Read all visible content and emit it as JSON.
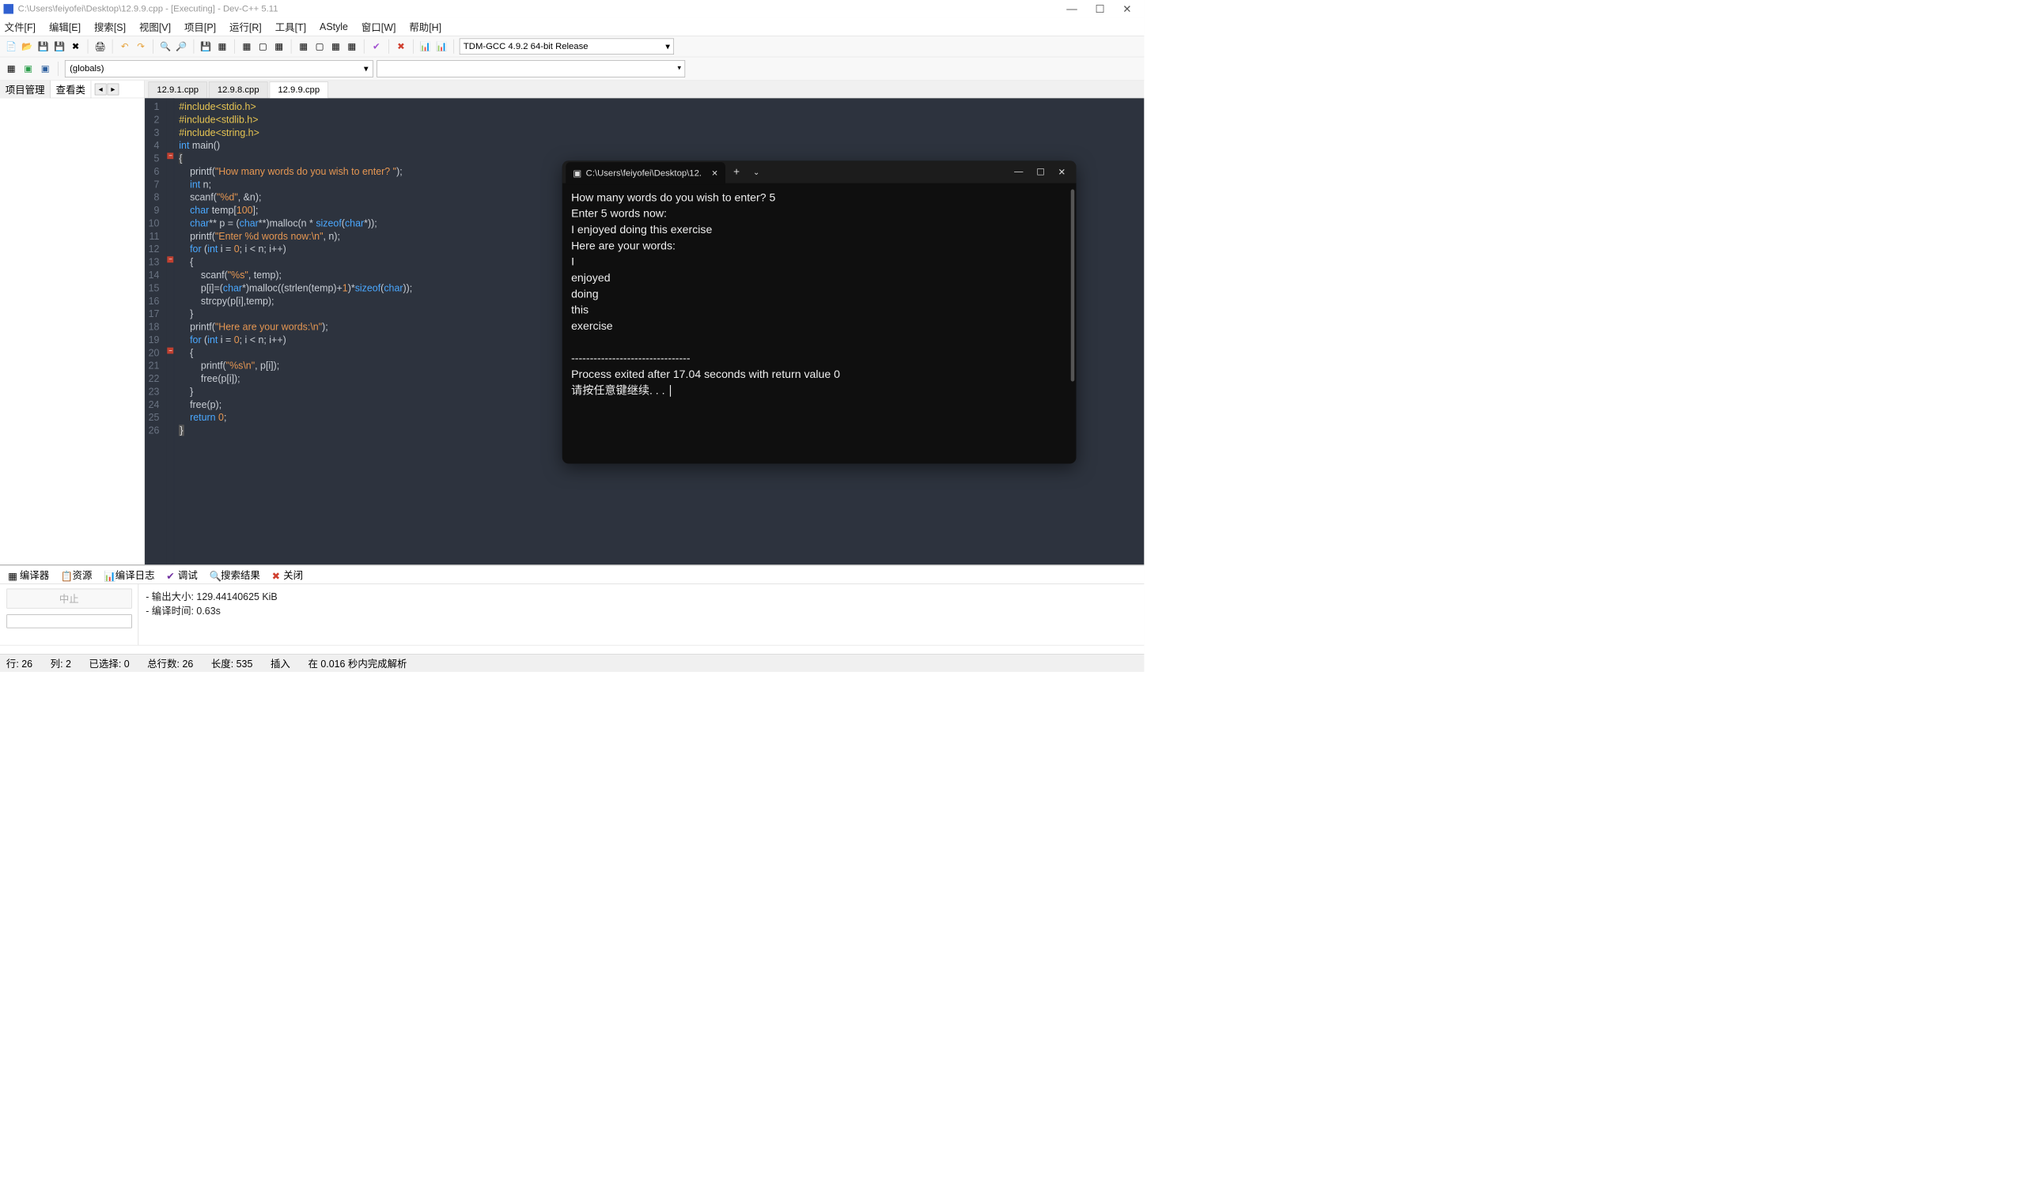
{
  "window": {
    "title": "C:\\Users\\feiyofei\\Desktop\\12.9.9.cpp - [Executing] - Dev-C++ 5.11"
  },
  "menu": {
    "file": "文件[F]",
    "edit": "编辑[E]",
    "search": "搜索[S]",
    "view": "视图[V]",
    "project": "项目[P]",
    "run": "运行[R]",
    "tools": "工具[T]",
    "astyle": "AStyle",
    "window": "窗口[W]",
    "help": "帮助[H]"
  },
  "toolbar": {
    "compiler_combo": "TDM-GCC 4.9.2 64-bit Release",
    "globals": "(globals)"
  },
  "sidebar": {
    "tab_project": "项目管理",
    "tab_class": "查看类"
  },
  "tabs": [
    {
      "label": "12.9.1.cpp",
      "active": false
    },
    {
      "label": "12.9.8.cpp",
      "active": false
    },
    {
      "label": "12.9.9.cpp",
      "active": true
    }
  ],
  "code": {
    "lines": [
      {
        "n": 1,
        "html": "<span class='preproc'>#include&lt;stdio.h&gt;</span>"
      },
      {
        "n": 2,
        "html": "<span class='preproc'>#include&lt;stdlib.h&gt;</span>"
      },
      {
        "n": 3,
        "html": "<span class='preproc'>#include&lt;string.h&gt;</span>"
      },
      {
        "n": 4,
        "html": "<span class='type'>int</span> main()"
      },
      {
        "n": 5,
        "html": "<span class='bracket-hl'>{</span>"
      },
      {
        "n": 6,
        "html": "    printf(<span class='str'>\"How many words do you wish to enter? \"</span>);"
      },
      {
        "n": 7,
        "html": "    <span class='type'>int</span> n;"
      },
      {
        "n": 8,
        "html": "    scanf(<span class='str'>\"%d\"</span>, &amp;n);"
      },
      {
        "n": 9,
        "html": "    <span class='type'>char</span> temp[<span class='num'>100</span>];"
      },
      {
        "n": 10,
        "html": "    <span class='type'>char</span>** p = (<span class='type'>char</span>**)malloc(n * <span class='kw'>sizeof</span>(<span class='type'>char</span>*));"
      },
      {
        "n": 11,
        "html": "    printf(<span class='str'>\"Enter %d words now:\\n\"</span>, n);"
      },
      {
        "n": 12,
        "html": "    <span class='kw'>for</span> (<span class='type'>int</span> i = <span class='num'>0</span>; i &lt; n; i++)"
      },
      {
        "n": 13,
        "html": "    {"
      },
      {
        "n": 14,
        "html": "        scanf(<span class='str'>\"%s\"</span>, temp);"
      },
      {
        "n": 15,
        "html": "        p[i]=(<span class='type'>char</span>*)malloc((strlen(temp)+<span class='num'>1</span>)*<span class='kw'>sizeof</span>(<span class='type'>char</span>));"
      },
      {
        "n": 16,
        "html": "        strcpy(p[i],temp);"
      },
      {
        "n": 17,
        "html": "    }"
      },
      {
        "n": 18,
        "html": "    printf(<span class='str'>\"Here are your words:\\n\"</span>);"
      },
      {
        "n": 19,
        "html": "    <span class='kw'>for</span> (<span class='type'>int</span> i = <span class='num'>0</span>; i &lt; n; i++)"
      },
      {
        "n": 20,
        "html": "    {"
      },
      {
        "n": 21,
        "html": "        printf(<span class='str'>\"%s\\n\"</span>, p[i]);"
      },
      {
        "n": 22,
        "html": "        free(p[i]);"
      },
      {
        "n": 23,
        "html": "    }"
      },
      {
        "n": 24,
        "html": "    free(p);"
      },
      {
        "n": 25,
        "html": "    <span class='kw'>return</span> <span class='num'>0</span>;"
      },
      {
        "n": 26,
        "html": "<span class='fn-highlight'>}</span>"
      }
    ]
  },
  "bottom": {
    "tab_compiler": "编译器",
    "tab_resources": "资源",
    "tab_compilelog": "编译日志",
    "tab_debug": "调试",
    "tab_searchresults": "搜索结果",
    "tab_close": "关闭",
    "abort_btn": "中止",
    "log_line1": "- 输出大小: 129.44140625 KiB",
    "log_line2": "- 编译时间: 0.63s"
  },
  "statusbar": {
    "line": "行:   26",
    "col": "列:   2",
    "sel": "已选择:   0",
    "total": "总行数:   26",
    "length": "长度:   535",
    "insert": "插入",
    "parse": "在 0.016 秒内完成解析"
  },
  "terminal": {
    "tab_title": "C:\\Users\\feiyofei\\Desktop\\12.",
    "output": "How many words do you wish to enter? 5\nEnter 5 words now:\nI enjoyed doing this exercise\nHere are your words:\nI\nenjoyed\ndoing\nthis\nexercise\n\n--------------------------------\nProcess exited after 17.04 seconds with return value 0\n请按任意键继续. . . "
  }
}
